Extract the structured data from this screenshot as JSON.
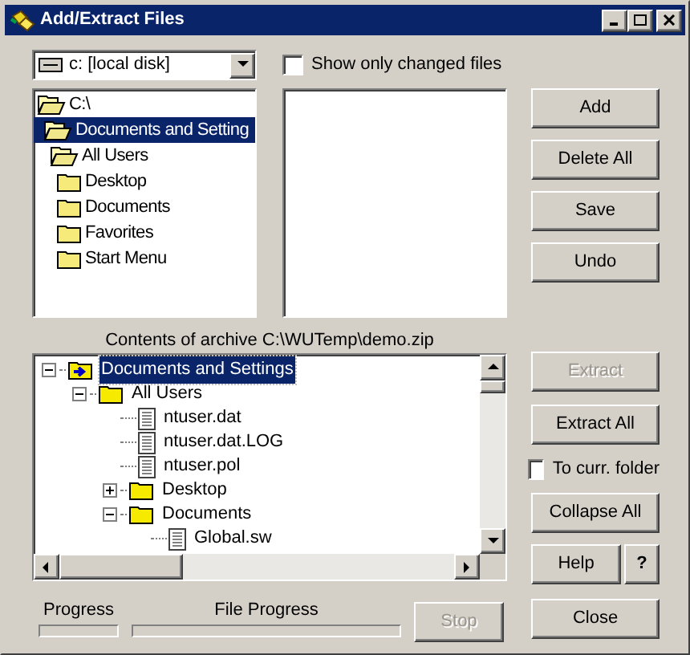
{
  "window": {
    "title": "Add/Extract Files"
  },
  "drive_select": {
    "value": "c: [local disk]"
  },
  "show_changed": {
    "label": "Show only changed files",
    "checked": false
  },
  "folder_tree": [
    {
      "label": "C:\\",
      "open": true,
      "selected": false,
      "children": [
        {
          "label": "Documents and Setting",
          "open": true,
          "selected": true,
          "children": [
            {
              "label": "All Users",
              "open": true,
              "selected": false,
              "children": [
                {
                  "label": "Desktop",
                  "open": false,
                  "selected": false
                },
                {
                  "label": "Documents",
                  "open": false,
                  "selected": false
                },
                {
                  "label": "Favorites",
                  "open": false,
                  "selected": false
                },
                {
                  "label": "Start Menu",
                  "open": false,
                  "selected": false
                }
              ]
            }
          ]
        }
      ]
    }
  ],
  "top_buttons": [
    {
      "label": "Add",
      "disabled": false
    },
    {
      "label": "Delete All",
      "disabled": false
    },
    {
      "label": "Save",
      "disabled": false
    },
    {
      "label": "Undo",
      "disabled": false
    }
  ],
  "archive_label": "Contents of archive C:\\WUTemp\\demo.zip",
  "archive_tree": [
    {
      "label": "Documents and Settings",
      "kind": "root",
      "expanded": true,
      "selected": true,
      "children": [
        {
          "label": "All Users",
          "kind": "folder",
          "expanded": true,
          "selected": false,
          "children": [
            {
              "label": "ntuser.dat",
              "kind": "file",
              "selected": false
            },
            {
              "label": "ntuser.dat.LOG",
              "kind": "file",
              "selected": false
            },
            {
              "label": "ntuser.pol",
              "kind": "file",
              "selected": false
            },
            {
              "label": "Desktop",
              "kind": "folder",
              "expanded": false,
              "selected": false
            },
            {
              "label": "Documents",
              "kind": "folder",
              "expanded": true,
              "selected": false,
              "children": [
                {
                  "label": "Global.sw",
                  "kind": "file",
                  "selected": false
                }
              ]
            }
          ]
        }
      ]
    }
  ],
  "extract_button": {
    "label": "Extract",
    "disabled": true
  },
  "extract_all_button": {
    "label": "Extract All",
    "disabled": false
  },
  "to_current_folder": {
    "label": "To curr. folder",
    "checked": false
  },
  "collapse_all_button": {
    "label": "Collapse All",
    "disabled": false
  },
  "help_button": {
    "label": "Help",
    "disabled": false
  },
  "question_button": {
    "label": "?",
    "disabled": false
  },
  "close_button": {
    "label": "Close",
    "disabled": false
  },
  "progress": {
    "label": "Progress",
    "level": 0
  },
  "file_progress": {
    "label": "File Progress",
    "level": 0
  },
  "stop_button": {
    "label": "Stop",
    "disabled": true
  }
}
